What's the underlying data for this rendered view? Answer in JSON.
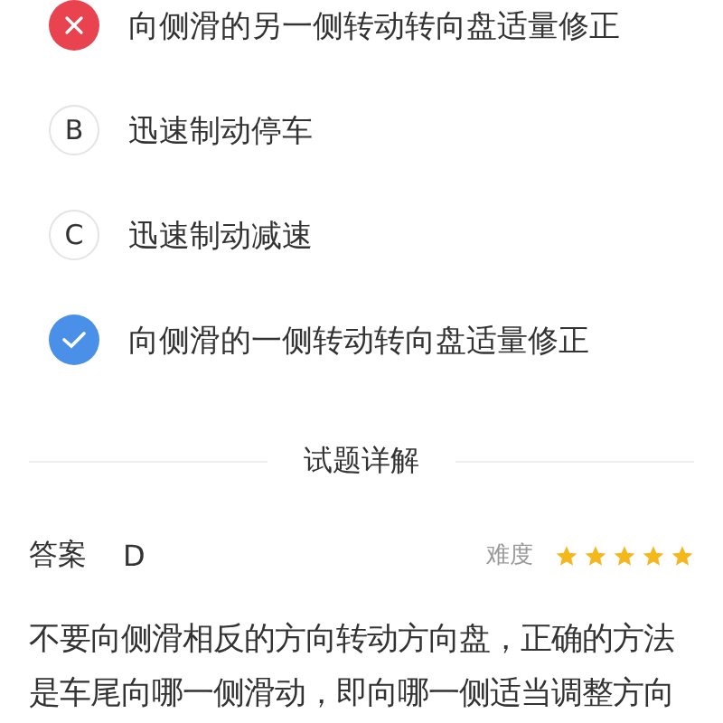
{
  "options": [
    {
      "kind": "wrong",
      "text": "向侧滑的另一侧转动转向盘适量修正"
    },
    {
      "kind": "letter",
      "letter": "B",
      "text": "迅速制动停车"
    },
    {
      "kind": "letter",
      "letter": "C",
      "text": "迅速制动减速"
    },
    {
      "kind": "correct",
      "text": "向侧滑的一侧转动转向盘适量修正"
    }
  ],
  "section_title": "试题详解",
  "answer": {
    "label": "答案",
    "value": "D"
  },
  "difficulty": {
    "label": "难度",
    "stars": 5
  },
  "explanation": "不要向侧滑相反的方向转动方向盘，正确的方法是车尾向哪一侧滑动，即向哪一侧适当调整方向"
}
